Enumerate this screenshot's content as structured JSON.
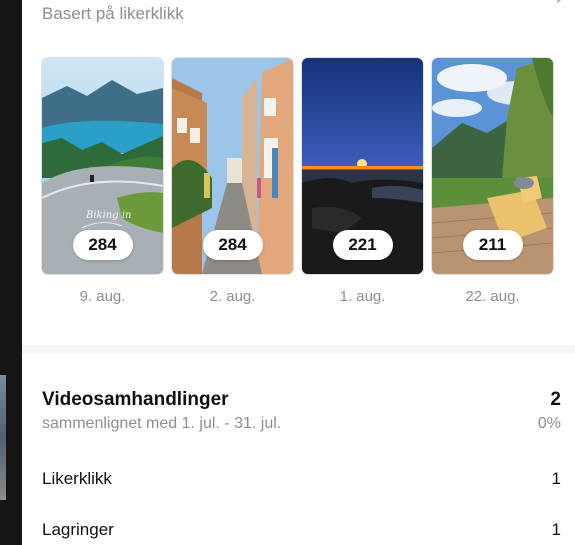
{
  "header": {
    "subtitle": "Basert på likerklikk"
  },
  "reels": [
    {
      "count": "284",
      "date": "9. aug.",
      "thumb_text": "Biking in"
    },
    {
      "count": "284",
      "date": "2. aug."
    },
    {
      "count": "221",
      "date": "1. aug."
    },
    {
      "count": "211",
      "date": "22. aug."
    }
  ],
  "interactions": {
    "title": "Videosamhandlinger",
    "value": "2",
    "comparison": "sammenlignet med 1. jul. - 31. jul.",
    "percent": "0%",
    "rows": [
      {
        "label": "Likerklikk",
        "value": "1"
      },
      {
        "label": "Lagringer",
        "value": "1"
      }
    ]
  }
}
